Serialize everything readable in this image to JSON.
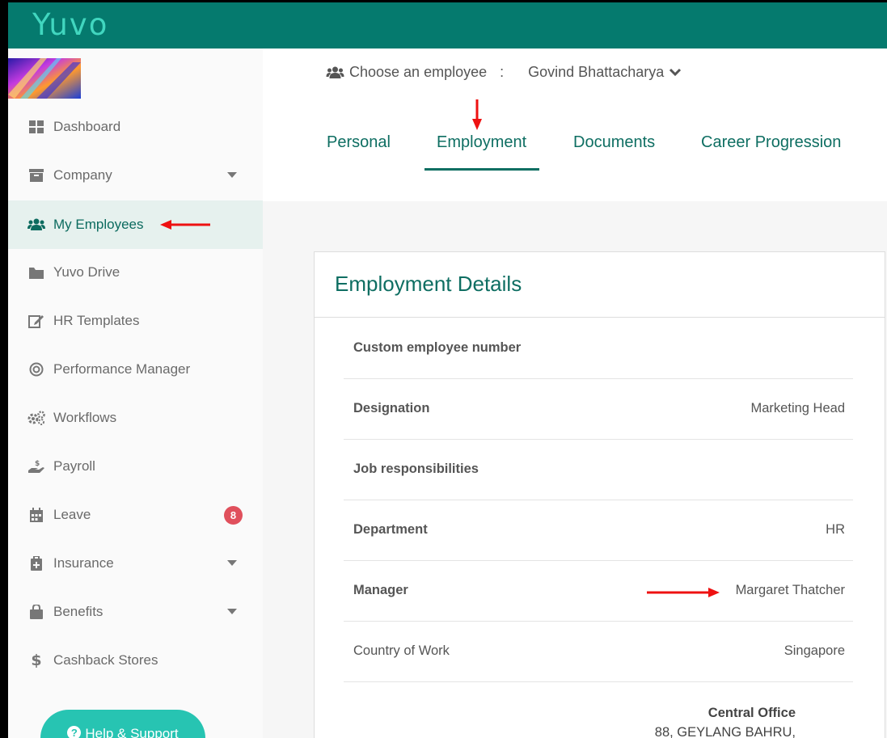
{
  "brand": {
    "logo": "Yuvo"
  },
  "sidebar": {
    "items": [
      {
        "label": "Dashboard",
        "icon": "dashboard-icon"
      },
      {
        "label": "Company",
        "icon": "archive-icon",
        "caret": true
      },
      {
        "label": "My Employees",
        "icon": "users-icon",
        "active": true
      },
      {
        "label": "Yuvo Drive",
        "icon": "folder-icon"
      },
      {
        "label": "HR Templates",
        "icon": "edit-icon"
      },
      {
        "label": "Performance Manager",
        "icon": "target-icon"
      },
      {
        "label": "Workflows",
        "icon": "gears-icon"
      },
      {
        "label": "Payroll",
        "icon": "hand-dollar-icon"
      },
      {
        "label": "Leave",
        "icon": "calendar-icon",
        "badge": "8"
      },
      {
        "label": "Insurance",
        "icon": "medical-briefcase-icon",
        "caret": true
      },
      {
        "label": "Benefits",
        "icon": "shopping-bag-icon",
        "caret": true
      },
      {
        "label": "Cashback Stores",
        "icon": "dollar-icon"
      }
    ],
    "help_button": "Help & Support"
  },
  "header": {
    "choose_label": "Choose an employee",
    "separator": ":",
    "selected_employee": "Govind Bhattacharya"
  },
  "tabs": [
    {
      "label": "Personal"
    },
    {
      "label": "Employment",
      "active": true
    },
    {
      "label": "Documents"
    },
    {
      "label": "Career Progression"
    }
  ],
  "employment": {
    "title": "Employment Details",
    "rows": [
      {
        "label": "Custom employee number",
        "value": "",
        "bold": true
      },
      {
        "label": "Designation",
        "value": "Marketing Head",
        "bold": true
      },
      {
        "label": "Job responsibilities",
        "value": "",
        "bold": true
      },
      {
        "label": "Department",
        "value": "HR",
        "bold": true
      },
      {
        "label": "Manager",
        "value": "Margaret Thatcher",
        "bold": true
      },
      {
        "label": "Country of Work",
        "value": "Singapore",
        "bold": false
      }
    ],
    "office": {
      "name": "Central Office",
      "address_line1": "88, GEYLANG BAHRU,"
    }
  },
  "colors": {
    "topbar": "#057a6e",
    "accent": "#0e6e62",
    "logo": "#41d6bf",
    "badge": "#e0505c",
    "help_button": "#27c4b2",
    "annotation_arrow": "#ee1111"
  }
}
